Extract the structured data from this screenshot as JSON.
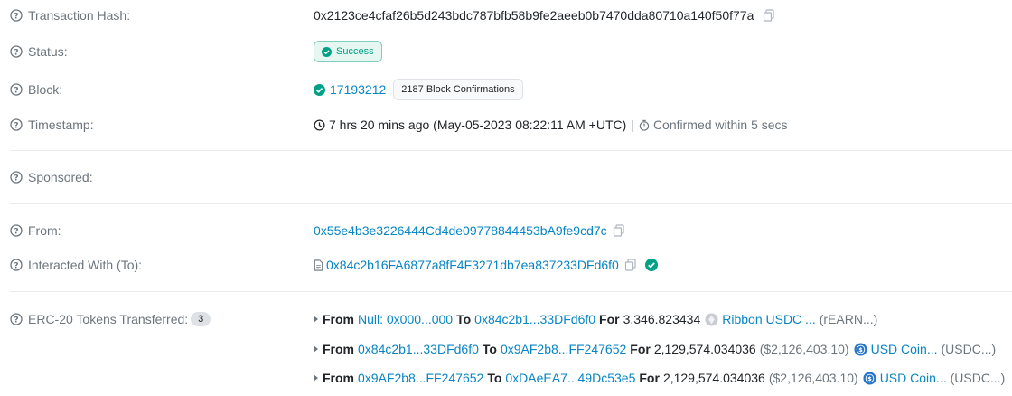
{
  "labels": {
    "tx_hash": "Transaction Hash:",
    "status": "Status:",
    "block": "Block:",
    "timestamp": "Timestamp:",
    "sponsored": "Sponsored:",
    "from": "From:",
    "interacted": "Interacted With (To):",
    "erc20": "ERC-20 Tokens Transferred:"
  },
  "tx_hash": "0x2123ce4cfaf26b5d243bdc787bfb58b9fe2aeeb0b7470dda80710a140f50f77a",
  "status": "Success",
  "block": {
    "number": "17193212",
    "confirmations": "2187 Block Confirmations"
  },
  "timestamp": {
    "text": "7 hrs 20 mins ago (May-05-2023 08:22:11 AM +UTC)",
    "separator": "|",
    "confirmed": "Confirmed within 5 secs"
  },
  "from_address": "0x55e4b3e3226444Cd4de09778844453bA9fe9cd7c",
  "to_address": "0x84c2b16FA6877a8fF4F3271db7ea837233DFd6f0",
  "erc20": {
    "count": "3",
    "transfers": [
      {
        "from_word": "From",
        "from": "Null: 0x000...000",
        "to_word": "To",
        "to": "0x84c2b1...33DFd6f0",
        "for_word": "For",
        "amount": "3,346.823434",
        "usd": "",
        "token_name": "Ribbon USDC ...",
        "token_symbol": "(rEARN...)",
        "icon": "ribbon-token-icon"
      },
      {
        "from_word": "From",
        "from": "0x84c2b1...33DFd6f0",
        "to_word": "To",
        "to": "0x9AF2b8...FF247652",
        "for_word": "For",
        "amount": "2,129,574.034036",
        "usd": "($2,126,403.10)",
        "token_name": "USD Coin...",
        "token_symbol": "(USDC...)",
        "icon": "usdc-token-icon"
      },
      {
        "from_word": "From",
        "from": "0x9AF2b8...FF247652",
        "to_word": "To",
        "to": "0xDAeEA7...49Dc53e5",
        "for_word": "For",
        "amount": "2,129,574.034036",
        "usd": "($2,126,403.10)",
        "token_name": "USD Coin...",
        "token_symbol": "(USDC...)",
        "icon": "usdc-token-icon"
      }
    ]
  },
  "colors": {
    "link": "#0784c3",
    "success": "#00a186",
    "muted": "#6c757d"
  }
}
